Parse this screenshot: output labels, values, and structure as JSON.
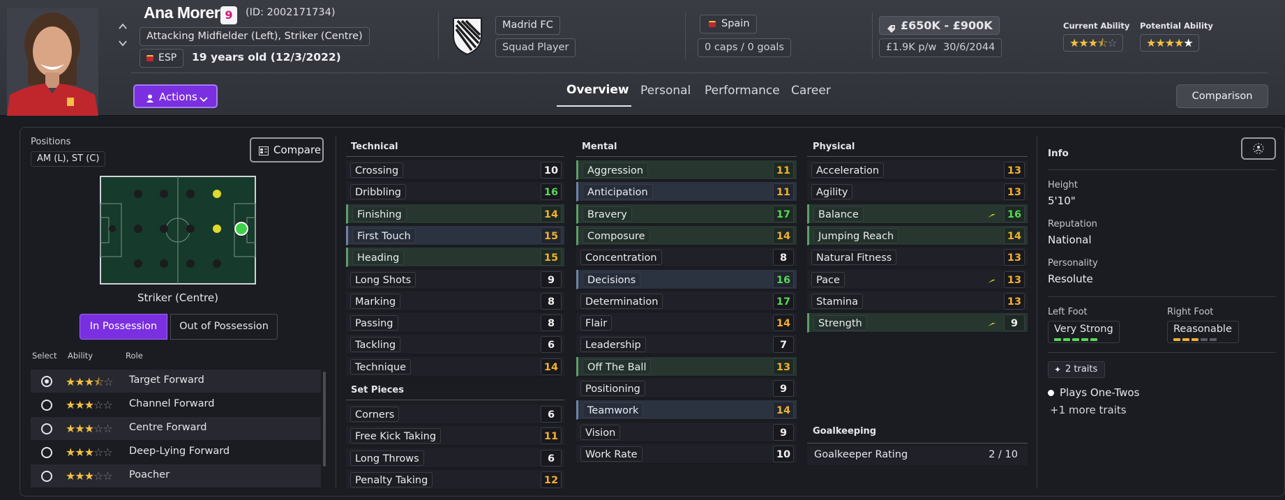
{
  "player": {
    "name": "Ana Morera",
    "number": "9",
    "id_text": "(ID: 2002171734)",
    "position_text": "Attacking Midfielder (Left), Striker (Centre)",
    "nationality_code": "ESP",
    "age_text": "19 years old (12/3/2022)"
  },
  "club": {
    "name": "Madrid FC",
    "status": "Squad Player"
  },
  "nation": {
    "name": "Spain",
    "caps": "0 caps / 0 goals"
  },
  "value": {
    "range": "£650K - £900K",
    "wage": "£1.9K p/w",
    "contract": "30/6/2044"
  },
  "ability": {
    "current_label": "Current Ability",
    "current_stars": 3.5,
    "potential_label": "Potential Ability",
    "potential_stars": 4.5
  },
  "actions_label": "Actions",
  "tabs": [
    "Overview",
    "Personal",
    "Performance",
    "Career"
  ],
  "comparison_label": "Comparison",
  "positions": {
    "title": "Positions",
    "value": "AM (L), ST (C)",
    "compare_label": "Compare",
    "selected_position": "Striker (Centre)",
    "in_possession": "In Possession",
    "out_of_possession": "Out of Possession"
  },
  "roles": {
    "headers": [
      "Select",
      "Ability",
      "Role"
    ],
    "items": [
      {
        "name": "Target Forward",
        "stars": 3.5,
        "selected": true
      },
      {
        "name": "Channel Forward",
        "stars": 3,
        "selected": false
      },
      {
        "name": "Centre Forward",
        "stars": 3,
        "selected": false
      },
      {
        "name": "Deep-Lying Forward",
        "stars": 3,
        "selected": false
      },
      {
        "name": "Poacher",
        "stars": 3,
        "selected": false
      }
    ]
  },
  "technical": {
    "title": "Technical",
    "items": [
      {
        "name": "Crossing",
        "value": "10"
      },
      {
        "name": "Dribbling",
        "value": "16"
      },
      {
        "name": "Finishing",
        "value": "14"
      },
      {
        "name": "First Touch",
        "value": "15"
      },
      {
        "name": "Heading",
        "value": "15"
      },
      {
        "name": "Long Shots",
        "value": "9"
      },
      {
        "name": "Marking",
        "value": "8"
      },
      {
        "name": "Passing",
        "value": "8"
      },
      {
        "name": "Tackling",
        "value": "6"
      },
      {
        "name": "Technique",
        "value": "14"
      }
    ]
  },
  "set_pieces": {
    "title": "Set Pieces",
    "items": [
      {
        "name": "Corners",
        "value": "6"
      },
      {
        "name": "Free Kick Taking",
        "value": "11"
      },
      {
        "name": "Long Throws",
        "value": "6"
      },
      {
        "name": "Penalty Taking",
        "value": "12"
      }
    ]
  },
  "mental": {
    "title": "Mental",
    "items": [
      {
        "name": "Aggression",
        "value": "11"
      },
      {
        "name": "Anticipation",
        "value": "11"
      },
      {
        "name": "Bravery",
        "value": "17"
      },
      {
        "name": "Composure",
        "value": "14"
      },
      {
        "name": "Concentration",
        "value": "8"
      },
      {
        "name": "Decisions",
        "value": "16"
      },
      {
        "name": "Determination",
        "value": "17"
      },
      {
        "name": "Flair",
        "value": "14"
      },
      {
        "name": "Leadership",
        "value": "7"
      },
      {
        "name": "Off The Ball",
        "value": "13"
      },
      {
        "name": "Positioning",
        "value": "9"
      },
      {
        "name": "Teamwork",
        "value": "14"
      },
      {
        "name": "Vision",
        "value": "9"
      },
      {
        "name": "Work Rate",
        "value": "10"
      }
    ]
  },
  "physical": {
    "title": "Physical",
    "items": [
      {
        "name": "Acceleration",
        "value": "13"
      },
      {
        "name": "Agility",
        "value": "13"
      },
      {
        "name": "Balance",
        "value": "16"
      },
      {
        "name": "Jumping Reach",
        "value": "14"
      },
      {
        "name": "Natural Fitness",
        "value": "13"
      },
      {
        "name": "Pace",
        "value": "13"
      },
      {
        "name": "Stamina",
        "value": "13"
      },
      {
        "name": "Strength",
        "value": "9"
      }
    ]
  },
  "goalkeeping": {
    "title": "Goalkeeping",
    "label": "Goalkeeper Rating",
    "value": "2 / 10"
  },
  "info": {
    "title": "Info",
    "height_label": "Height",
    "height": "5'10\"",
    "reputation_label": "Reputation",
    "reputation": "National",
    "personality_label": "Personality",
    "personality": "Resolute",
    "left_foot_label": "Left Foot",
    "left_foot": "Very Strong",
    "left_foot_level": 5,
    "right_foot_label": "Right Foot",
    "right_foot": "Reasonable",
    "right_foot_level": 3,
    "traits_label": "2 traits",
    "trait_1": "Plays One-Twos",
    "more_traits": "+1 more traits"
  },
  "colors": {
    "accent": "#7a2fe0",
    "good": "#59d658",
    "mid": "#f0b030",
    "club_green_row": "#27372f",
    "club_blue_row": "#2b3240"
  }
}
